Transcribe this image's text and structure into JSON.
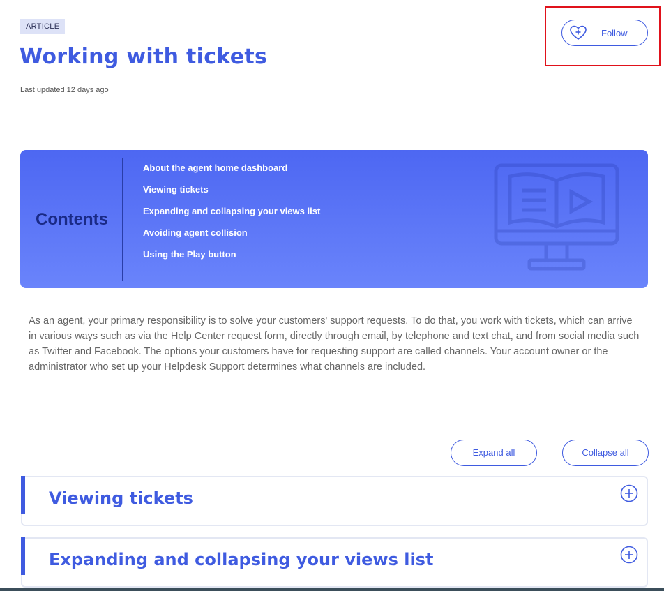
{
  "header": {
    "badge": "ARTICLE",
    "title": "Working with tickets",
    "last_updated": "Last updated 12 days ago",
    "follow_label": "Follow"
  },
  "contents": {
    "heading": "Contents",
    "items": [
      "About the agent home dashboard",
      "Viewing tickets",
      "Expanding and collapsing your views list",
      "Avoiding agent collision",
      "Using the Play button"
    ]
  },
  "intro": "As an agent, your primary responsibility is to solve your customers' support requests. To do that, you work with tickets, which can arrive in various ways such as via the Help Center request form, directly through email, by telephone and text chat, and from social media such as Twitter and Facebook. The options your customers have for requesting support are called channels. Your account owner or the administrator who set up your Helpdesk Support determines what channels are included.",
  "controls": {
    "expand_all": "Expand all",
    "collapse_all": "Collapse all"
  },
  "sections": [
    {
      "title": "Viewing tickets"
    },
    {
      "title": "Expanding and collapsing your views list"
    }
  ],
  "colors": {
    "accent": "#3f5be0",
    "highlight": "#e0121b",
    "contents_bg": "#5671f5"
  }
}
